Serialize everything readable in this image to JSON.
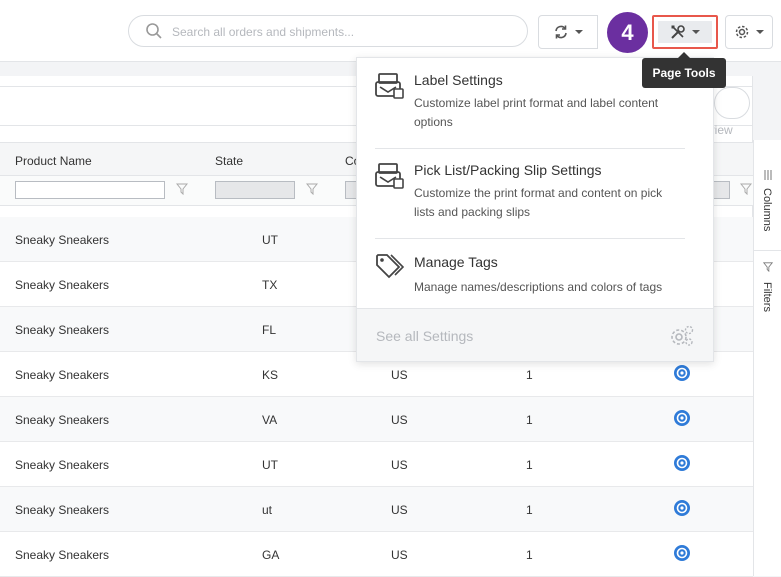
{
  "header": {
    "search_placeholder": "Search all orders and shipments...",
    "step_number": "4",
    "tooltip": "Page Tools"
  },
  "grid": {
    "columns": [
      "Product Name",
      "State",
      "Co"
    ],
    "view_partial": "t view",
    "rows": [
      {
        "product": "Sneaky Sneakers",
        "state": "UT",
        "country": "",
        "qty": ""
      },
      {
        "product": "Sneaky Sneakers",
        "state": "TX",
        "country": "",
        "qty": ""
      },
      {
        "product": "Sneaky Sneakers",
        "state": "FL",
        "country": "",
        "qty": ""
      },
      {
        "product": "Sneaky Sneakers",
        "state": "KS",
        "country": "US",
        "qty": "1"
      },
      {
        "product": "Sneaky Sneakers",
        "state": "VA",
        "country": "US",
        "qty": "1"
      },
      {
        "product": "Sneaky Sneakers",
        "state": "UT",
        "country": "US",
        "qty": "1"
      },
      {
        "product": "Sneaky Sneakers",
        "state": "ut",
        "country": "US",
        "qty": "1"
      },
      {
        "product": "Sneaky Sneakers",
        "state": "GA",
        "country": "US",
        "qty": "1"
      }
    ],
    "side_tabs": [
      "Columns",
      "Filters"
    ]
  },
  "dropdown": {
    "items": [
      {
        "title": "Label Settings",
        "desc": "Customize label print format and label content options",
        "icon": "label-printer-icon"
      },
      {
        "title": "Pick List/Packing Slip Settings",
        "desc": "Customize the print format and content on pick lists and packing slips",
        "icon": "packing-slip-icon"
      },
      {
        "title": "Manage Tags",
        "desc": "Manage names/descriptions and colors of tags",
        "icon": "tags-icon"
      }
    ],
    "see_all": "See all Settings"
  },
  "colors": {
    "step_badge": "#6b2fa0",
    "highlight_border": "#e8574b",
    "status_icon": "#2f7bd8"
  }
}
